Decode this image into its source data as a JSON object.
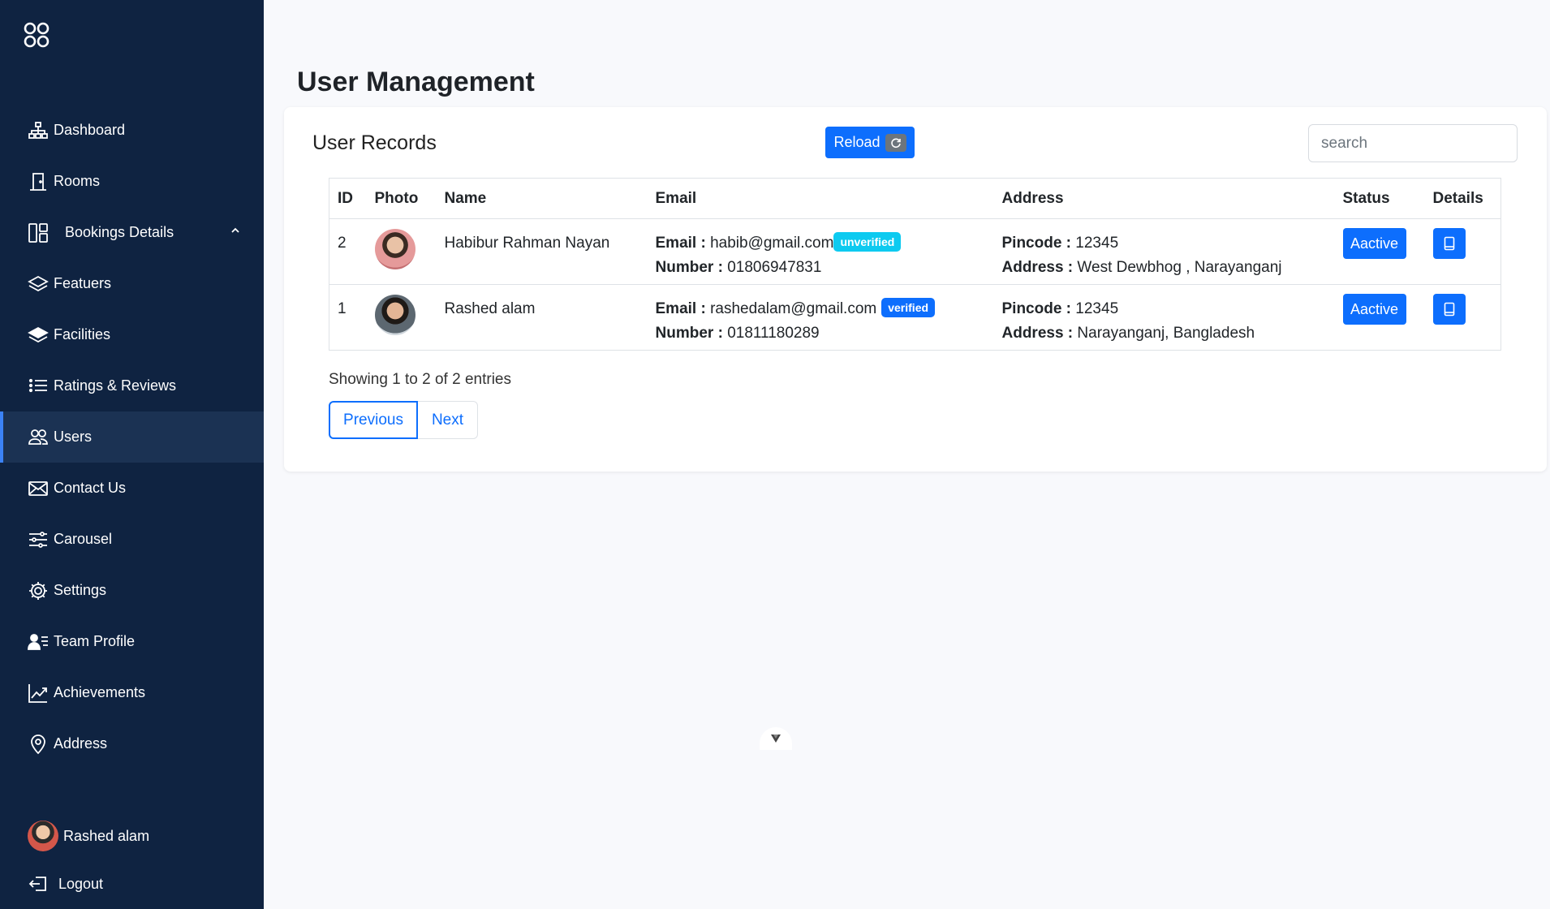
{
  "sidebar": {
    "logo_icon": "grid-circles-icon",
    "items": [
      {
        "label": "Dashboard",
        "icon": "sitemap-icon"
      },
      {
        "label": "Rooms",
        "icon": "door-icon"
      },
      {
        "label": "Bookings Details",
        "icon": "layout-icon"
      },
      {
        "label": "Featuers",
        "icon": "layers-icon"
      },
      {
        "label": "Facilities",
        "icon": "layers-fill-icon"
      },
      {
        "label": "Ratings & Reviews",
        "icon": "list-icon"
      },
      {
        "label": "Users",
        "icon": "people-icon"
      },
      {
        "label": "Contact Us",
        "icon": "envelope-icon"
      },
      {
        "label": "Carousel",
        "icon": "sliders-icon"
      },
      {
        "label": "Settings",
        "icon": "gear-icon"
      },
      {
        "label": "Team Profile",
        "icon": "person-lines-icon"
      },
      {
        "label": "Achievements",
        "icon": "graph-up-icon"
      },
      {
        "label": "Address",
        "icon": "geo-icon"
      }
    ],
    "active": "Users",
    "user_name": "Rashed alam",
    "logout_label": "Logout"
  },
  "header": {
    "title": "User Management"
  },
  "card": {
    "title": "User Records",
    "reload_label": "Reload",
    "search_placeholder": "search"
  },
  "table": {
    "columns": [
      "ID",
      "Photo",
      "Name",
      "Email",
      "Address",
      "Status",
      "Details"
    ],
    "rows": [
      {
        "id": "2",
        "name": "Habibur Rahman Nayan",
        "email_label": "Email :",
        "email": "habib@gmail.com",
        "verification": "unverified",
        "number_label": "Number :",
        "number": "01806947831",
        "pincode_label": "Pincode :",
        "pincode": "12345",
        "address_label": "Address :",
        "address": "West Dewbhog , Narayanganj",
        "status": "Aactive"
      },
      {
        "id": "1",
        "name": "Rashed alam",
        "email_label": "Email :",
        "email": "rashedalam@gmail.com",
        "verification": "verified",
        "number_label": "Number :",
        "number": "01811180289",
        "pincode_label": "Pincode :",
        "pincode": "12345",
        "address_label": "Address :",
        "address": "Narayanganj, Bangladesh",
        "status": "Aactive"
      }
    ]
  },
  "pagination": {
    "summary": "Showing 1 to 2 of 2 entries",
    "previous_label": "Previous",
    "next_label": "Next"
  },
  "colors": {
    "sidebar_bg": "#0f2341",
    "accent": "#0d6efd",
    "badge_unverified": "#0dcaf0",
    "page_bg": "#f8f9fc"
  }
}
